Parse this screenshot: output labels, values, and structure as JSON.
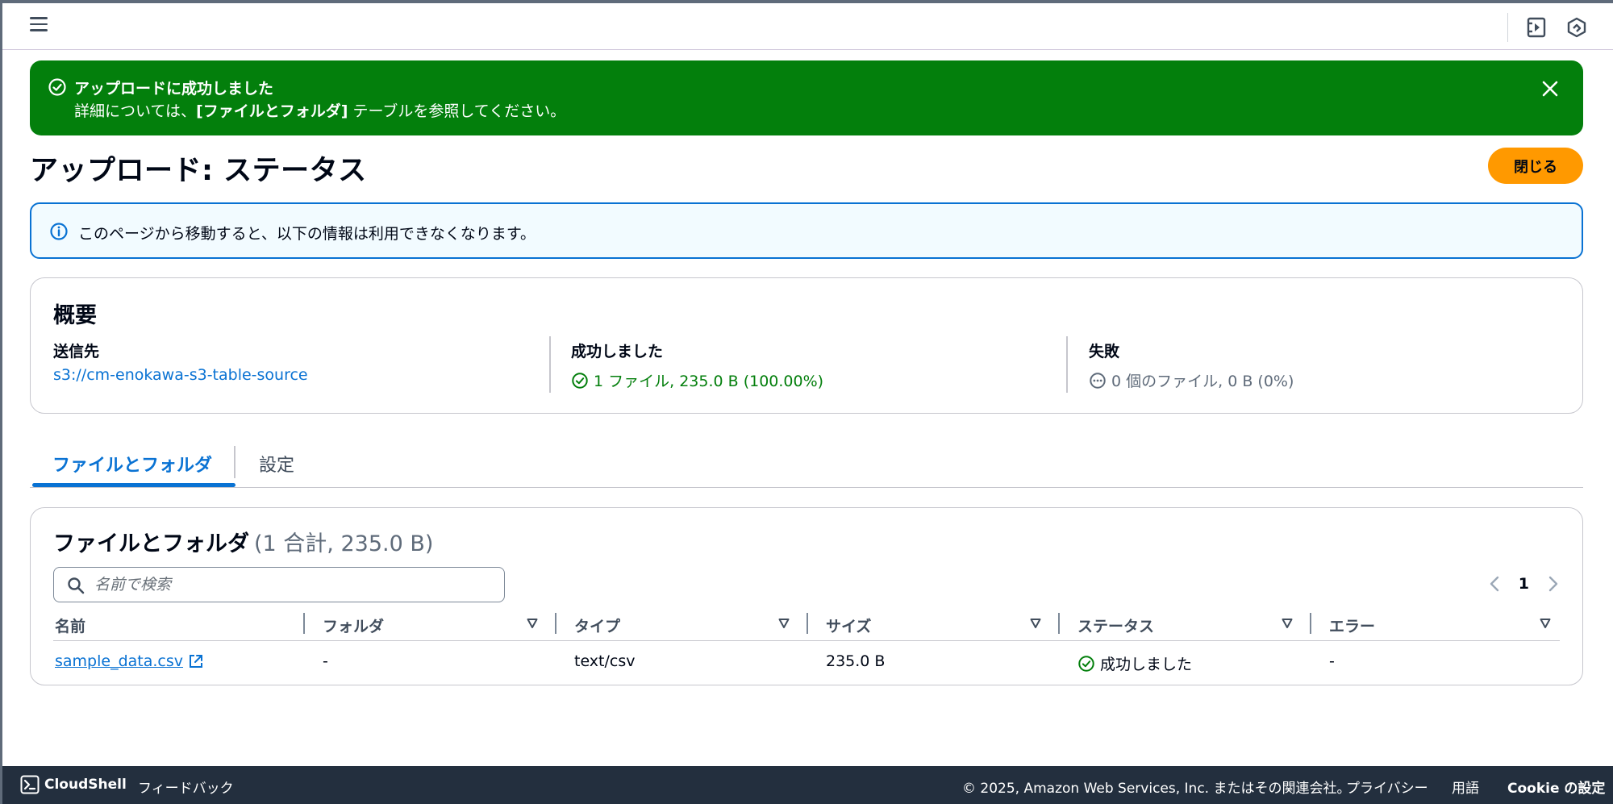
{
  "topbar": {
    "icons": [
      "menu-icon",
      "side-panel-icon",
      "q-assistant-icon"
    ]
  },
  "flash": {
    "title": "アップロードに成功しました",
    "body_prefix": "詳細については、",
    "body_bold": "[ファイルとフォルダ]",
    "body_suffix": " テーブルを参照してください。",
    "color": "#037f0c"
  },
  "header": {
    "title": "アップロード: ステータス",
    "close_label": "閉じる",
    "accent": "#ff9900"
  },
  "info": {
    "text": "このページから移動すると、以下の情報は利用できなくなります。"
  },
  "summary": {
    "title": "概要",
    "destination_label": "送信先",
    "destination_value": "s3://cm-enokawa-s3-table-source",
    "succeeded_label": "成功しました",
    "succeeded_value": "1 ファイル, 235.0 B (100.00%)",
    "failed_label": "失敗",
    "failed_value": "0 個のファイル, 0 B (0%)"
  },
  "tabs": [
    {
      "label": "ファイルとフォルダ",
      "active": true
    },
    {
      "label": "設定",
      "active": false
    }
  ],
  "files": {
    "title": "ファイルとフォルダ",
    "count": "(1 合計, 235.0 B)",
    "search_placeholder": "名前で検索",
    "page": "1",
    "columns": [
      "名前",
      "フォルダ",
      "タイプ",
      "サイズ",
      "ステータス",
      "エラー"
    ],
    "rows": [
      {
        "name": "sample_data.csv",
        "folder": "-",
        "type": "text/csv",
        "size": "235.0 B",
        "status": "成功しました",
        "error": "-"
      }
    ]
  },
  "footer": {
    "cloudshell": "CloudShell",
    "feedback": "フィードバック",
    "copyright": "© 2025, Amazon Web Services, Inc. またはその関連会社。",
    "privacy": "プライバシー",
    "terms": "用語",
    "cookie": "Cookie の設定"
  }
}
